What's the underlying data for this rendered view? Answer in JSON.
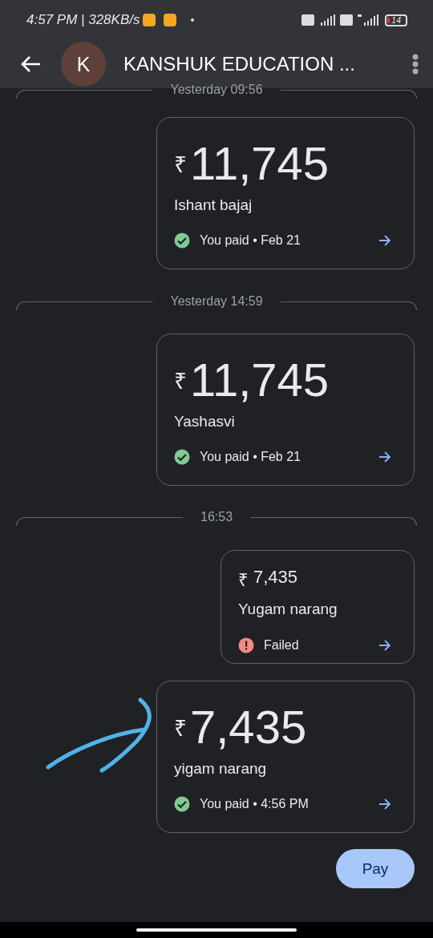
{
  "status_bar": {
    "time_speed": "4:57 PM | 328KB/s",
    "battery": "14"
  },
  "header": {
    "avatar_letter": "K",
    "title": "KANSHUK EDUCATION ..."
  },
  "messages": [
    {
      "kind": "divider",
      "label": "Yesterday 09:56"
    },
    {
      "kind": "payment",
      "compact": false,
      "currency": "₹",
      "amount": "11,745",
      "name": "Ishant bajaj",
      "failed": false,
      "status_text": "You paid • Feb 21"
    },
    {
      "kind": "divider",
      "label": "Yesterday 14:59"
    },
    {
      "kind": "payment",
      "compact": false,
      "currency": "₹",
      "amount": "11,745",
      "name": "Yashasvi",
      "failed": false,
      "status_text": "You paid • Feb 21"
    },
    {
      "kind": "divider",
      "label": "16:53"
    },
    {
      "kind": "payment",
      "compact": true,
      "currency": "₹",
      "amount": "7,435",
      "name": "Yugam narang",
      "failed": true,
      "status_text": "Failed"
    },
    {
      "kind": "payment",
      "compact": false,
      "currency": "₹",
      "amount": "7,435",
      "name": "yigam narang",
      "failed": false,
      "status_text": "You paid • 4:56 PM"
    }
  ],
  "pay_button": "Pay"
}
